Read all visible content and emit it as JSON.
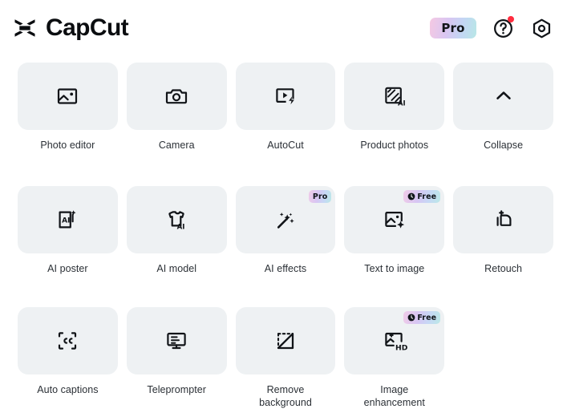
{
  "header": {
    "brand_name": "CapCut",
    "logo_icon": "capcut-logo-icon",
    "pro_label": "Pro",
    "help_icon": "question-mark-circle-icon",
    "settings_icon": "gear-icon",
    "notification_dot": true,
    "pro_gradient": "#f5c9e2 → #b8e7e6"
  },
  "colors": {
    "page_background": "#ffffff",
    "tile_background": "#eef1f3",
    "icon": "#111418",
    "label": "#2b3036",
    "notification_red": "#ff2d3f"
  },
  "grid": {
    "rows": [
      {
        "row_name": "row-1",
        "items": [
          {
            "label": "Photo editor",
            "icon": "photo-editor-icon",
            "badge": null
          },
          {
            "label": "Camera",
            "icon": "camera-icon",
            "badge": null
          },
          {
            "label": "AutoCut",
            "icon": "autocut-icon",
            "badge": null
          },
          {
            "label": "Product photos",
            "icon": "product-photos-ai-icon",
            "badge": null
          },
          {
            "label": "Collapse",
            "icon": "chevron-up-icon",
            "badge": null
          }
        ]
      },
      {
        "row_name": "row-2",
        "items": [
          {
            "label": "AI poster",
            "icon": "ai-poster-icon",
            "badge": null
          },
          {
            "label": "AI model",
            "icon": "ai-model-tshirt-icon",
            "badge": null
          },
          {
            "label": "AI effects",
            "icon": "magic-wand-icon",
            "badge": {
              "type": "pro",
              "text": "Pro"
            }
          },
          {
            "label": "Text to image",
            "icon": "text-to-image-icon",
            "badge": {
              "type": "free",
              "text": "Free"
            }
          },
          {
            "label": "Retouch",
            "icon": "retouch-icon",
            "badge": null
          }
        ]
      },
      {
        "row_name": "row-3",
        "items": [
          {
            "label": "Auto captions",
            "icon": "closed-captions-icon",
            "badge": null
          },
          {
            "label": "Teleprompter",
            "icon": "teleprompter-icon",
            "badge": null
          },
          {
            "label": "Remove\nbackground",
            "icon": "remove-background-icon",
            "badge": null
          },
          {
            "label": "Image\nenhancement",
            "icon": "image-enhancement-hd-icon",
            "badge": {
              "type": "free",
              "text": "Free"
            }
          }
        ]
      }
    ]
  }
}
